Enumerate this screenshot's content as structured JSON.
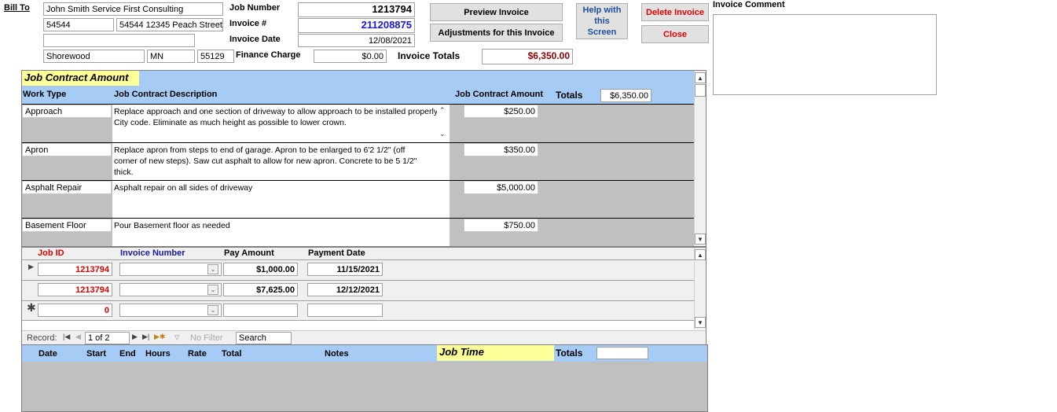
{
  "header": {
    "bill_to_label": "Bill To",
    "customer_name": "John Smith Service First Consulting",
    "customer_id": "54544",
    "address_line": "54544 12345 Peach Street",
    "address_line2": "",
    "city": "Shorewood",
    "state": "MN",
    "zip": "55129",
    "job_number_label": "Job Number",
    "job_number": "1213794",
    "invoice_no_label": "Invoice #",
    "invoice_no": "211208875",
    "invoice_date_label": "Invoice Date",
    "invoice_date": "12/08/2021",
    "finance_charge_label": "Finance Charge",
    "finance_charge": "$0.00",
    "invoice_totals_label": "Invoice Totals",
    "invoice_totals": "$6,350.00",
    "preview_label": "Preview Invoice",
    "adjustments_label": "Adjustments for this Invoice",
    "help_label": "Help with this Screen",
    "delete_label": "Delete Invoice",
    "close_label": "Close",
    "comment_label": "Invoice Comment",
    "comment_value": ""
  },
  "contract": {
    "title": "Job Contract Amount",
    "col_work_type": "Work Type",
    "col_description": "Job Contract Description",
    "col_amount": "Job Contract Amount",
    "totals_label": "Totals",
    "totals_value": "$6,350.00",
    "rows": [
      {
        "work_type": "Approach",
        "description": "Replace approach and one section of driveway to allow approach to be installed properly to City code. Eliminate as much height as possible to lower crown.",
        "amount": "$250.00"
      },
      {
        "work_type": "Apron",
        "description": "Replace apron from steps to end of garage. Apron to be enlarged to 6'2 1/2\" (off corner of new steps). Saw cut asphalt to allow for new apron. Concrete to be 5 1/2\" thick.",
        "amount": "$350.00"
      },
      {
        "work_type": "Asphalt Repair",
        "description": "Asphalt repair on all sides of driveway",
        "amount": "$5,000.00"
      },
      {
        "work_type": "Basement Floor",
        "description": "Pour Basement floor as needed",
        "amount": "$750.00"
      }
    ]
  },
  "payments": {
    "col_job_id": "Job ID",
    "col_invoice_number": "Invoice Number",
    "col_pay_amount": "Pay Amount",
    "col_payment_date": "Payment Date",
    "rows": [
      {
        "job_id": "1213794",
        "invoice_number": "",
        "pay_amount": "$1,000.00",
        "payment_date": "11/15/2021"
      },
      {
        "job_id": "1213794",
        "invoice_number": "",
        "pay_amount": "$7,625.00",
        "payment_date": "12/12/2021"
      }
    ],
    "new_row": {
      "job_id": "0"
    },
    "nav": {
      "record_label": "Record:",
      "position": "1 of 2",
      "no_filter": "No Filter",
      "search": "Search"
    },
    "colors": {
      "job_id": "#e00000",
      "invoice_number": "#1a1aa0"
    }
  },
  "job_time": {
    "col_date": "Date",
    "col_start": "Start",
    "col_end": "End",
    "col_hours": "Hours",
    "col_rate": "Rate",
    "col_total": "Total",
    "col_notes": "Notes",
    "title": "Job Time",
    "totals_label": "Totals",
    "totals_value": ""
  }
}
